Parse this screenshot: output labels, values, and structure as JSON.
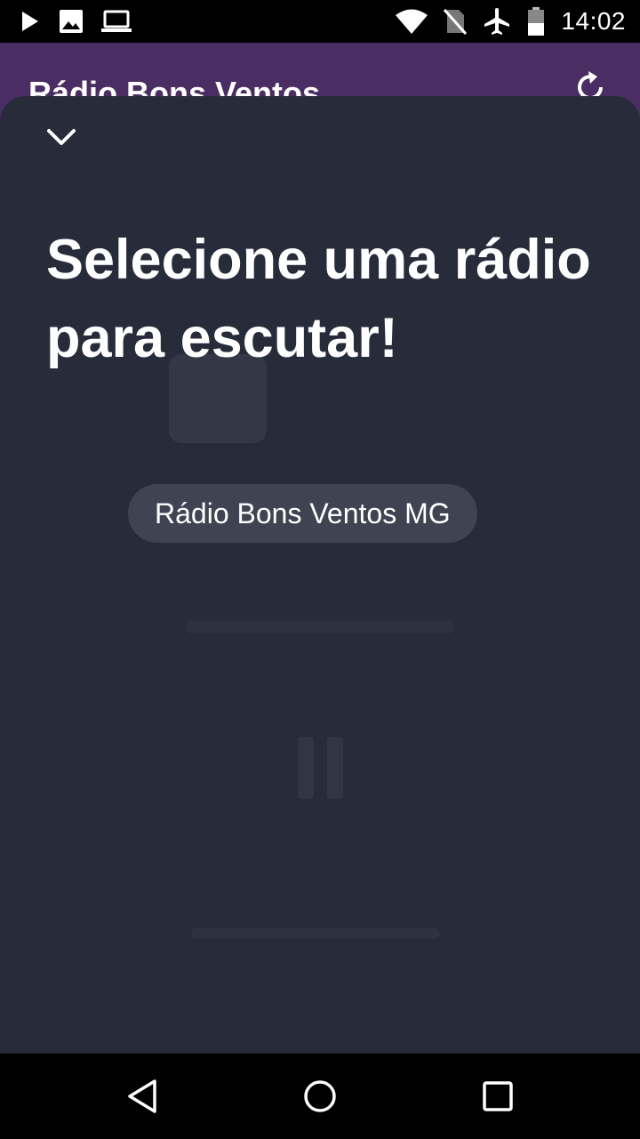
{
  "status_bar": {
    "time": "14:02",
    "left_icons": [
      "play-store-icon",
      "image-icon",
      "laptop-icon"
    ],
    "right_icons": [
      "wifi-icon",
      "no-sim-icon",
      "airplane-icon",
      "battery-icon"
    ]
  },
  "app_bar": {
    "title": "Rádio Bons Ventos",
    "action_icon": "refresh-icon",
    "background_color": "#4a2d63"
  },
  "sheet": {
    "collapse_icon": "chevron-down-icon",
    "title": "Selecione uma rádio para escutar!",
    "stations": [
      "Rádio Bons Ventos MG"
    ],
    "background_color": "#282b3a"
  },
  "nav_bar": {
    "icons": [
      "back-icon",
      "home-icon",
      "recents-icon"
    ]
  }
}
